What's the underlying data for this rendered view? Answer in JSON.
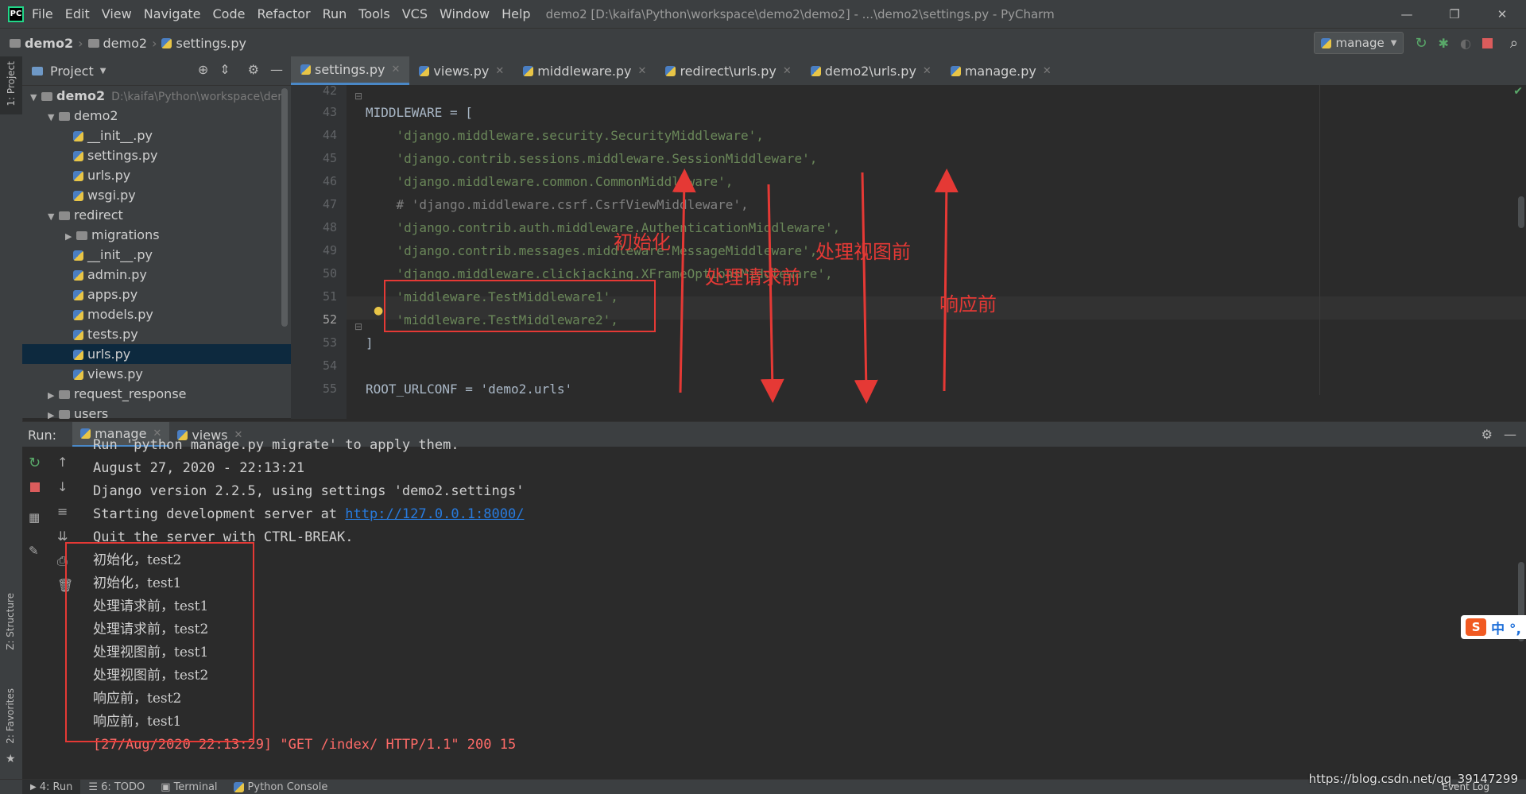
{
  "window": {
    "title": "demo2 [D:\\kaifa\\Python\\workspace\\demo2\\demo2] - ...\\demo2\\settings.py - PyCharm",
    "menu": [
      "File",
      "Edit",
      "View",
      "Navigate",
      "Code",
      "Refactor",
      "Run",
      "Tools",
      "VCS",
      "Window",
      "Help"
    ]
  },
  "breadcrumb": [
    "demo2",
    "demo2",
    "settings.py"
  ],
  "run_config": "manage",
  "project_panel": {
    "title": "Project",
    "tree": [
      {
        "label": "demo2",
        "path": "D:\\kaifa\\Python\\workspace\\dem",
        "type": "folder",
        "depth": 0,
        "open": true
      },
      {
        "label": "demo2",
        "type": "folder",
        "depth": 1,
        "open": true
      },
      {
        "label": "__init__.py",
        "type": "py",
        "depth": 2
      },
      {
        "label": "settings.py",
        "type": "py",
        "depth": 2
      },
      {
        "label": "urls.py",
        "type": "py",
        "depth": 2
      },
      {
        "label": "wsgi.py",
        "type": "py",
        "depth": 2
      },
      {
        "label": "redirect",
        "type": "folder",
        "depth": 1,
        "open": true
      },
      {
        "label": "migrations",
        "type": "folder",
        "depth": 2,
        "open": false
      },
      {
        "label": "__init__.py",
        "type": "py",
        "depth": 2
      },
      {
        "label": "admin.py",
        "type": "py",
        "depth": 2
      },
      {
        "label": "apps.py",
        "type": "py",
        "depth": 2
      },
      {
        "label": "models.py",
        "type": "py",
        "depth": 2
      },
      {
        "label": "tests.py",
        "type": "py",
        "depth": 2
      },
      {
        "label": "urls.py",
        "type": "py",
        "depth": 2,
        "selected": true
      },
      {
        "label": "views.py",
        "type": "py",
        "depth": 2
      },
      {
        "label": "request_response",
        "type": "folder",
        "depth": 1,
        "open": false
      },
      {
        "label": "users",
        "type": "folder",
        "depth": 1,
        "open": false
      }
    ]
  },
  "editor_tabs": [
    {
      "label": "settings.py",
      "active": true
    },
    {
      "label": "views.py"
    },
    {
      "label": "middleware.py"
    },
    {
      "label": "redirect\\urls.py"
    },
    {
      "label": "demo2\\urls.py"
    },
    {
      "label": "manage.py"
    }
  ],
  "code_lines": [
    {
      "n": "42",
      "text": ""
    },
    {
      "n": "43",
      "text": "MIDDLEWARE = ["
    },
    {
      "n": "44",
      "text": "    'django.middleware.security.SecurityMiddleware',"
    },
    {
      "n": "45",
      "text": "    'django.contrib.sessions.middleware.SessionMiddleware',"
    },
    {
      "n": "46",
      "text": "    'django.middleware.common.CommonMiddleware',"
    },
    {
      "n": "47",
      "text": "    # 'django.middleware.csrf.CsrfViewMiddleware',"
    },
    {
      "n": "48",
      "text": "    'django.contrib.auth.middleware.AuthenticationMiddleware',"
    },
    {
      "n": "49",
      "text": "    'django.contrib.messages.middleware.MessageMiddleware',"
    },
    {
      "n": "50",
      "text": "    'django.middleware.clickjacking.XFrameOptionsMiddleware',"
    },
    {
      "n": "51",
      "text": "    'middleware.TestMiddleware1',"
    },
    {
      "n": "52",
      "text": "    'middleware.TestMiddleware2',"
    },
    {
      "n": "53",
      "text": "]"
    },
    {
      "n": "54",
      "text": ""
    },
    {
      "n": "55",
      "text": "ROOT_URLCONF = 'demo2.urls'"
    }
  ],
  "annotations": {
    "init": "初始化",
    "before_request": "处理请求前",
    "before_view": "处理视图前",
    "before_response": "响应前"
  },
  "run_panel": {
    "label": "Run:",
    "tabs": [
      "manage",
      "views"
    ],
    "lines": [
      "Run 'python manage.py migrate' to apply them.",
      "August 27, 2020 - 22:13:21",
      "Django version 2.2.5, using settings 'demo2.settings'",
      "Starting development server at ",
      "Quit the server with CTRL-BREAK.",
      "初始化，test2",
      "初始化，test1",
      "处理请求前，test1",
      "处理请求前，test2",
      "处理视图前，test1",
      "处理视图前，test2",
      "响应前，test2",
      "响应前，test1",
      "[27/Aug/2020 22:13:29] \"GET /index/ HTTP/1.1\" 200 15"
    ],
    "server_link": "http://127.0.0.1:8000/"
  },
  "left_strip": {
    "project": "1: Project",
    "structure": "Z: Structure",
    "favorites": "2: Favorites"
  },
  "status_bar": {
    "tabs": [
      "4: Run",
      "6: TODO",
      "Terminal",
      "Python Console"
    ],
    "event_log": "Event Log",
    "watermark": "https://blog.csdn.net/qq_39147299"
  },
  "colors": {
    "accent": "#4a88c7",
    "annotation": "#e53935",
    "string": "#6a8759"
  }
}
